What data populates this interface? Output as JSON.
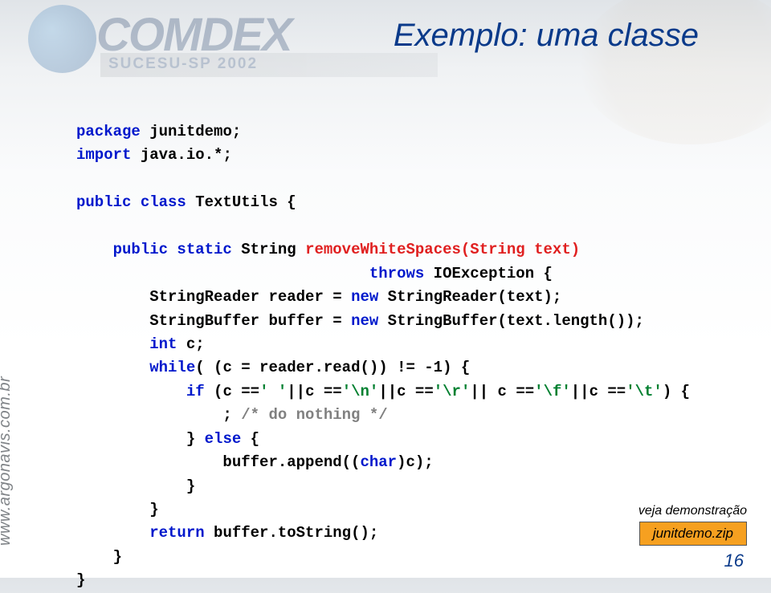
{
  "title": "Exemplo: uma  classe",
  "sidebar": "www.argonavis.com.br",
  "bg": {
    "comdex": "COMDEX",
    "sucesu": "SUCESU-SP 2002"
  },
  "code": {
    "l01a": "package",
    "l01b": " junitdemo;",
    "l02a": "import",
    "l02b": " java.io.*;",
    "l04a": "public class",
    "l04b": " TextUtils {",
    "l06a": "    ",
    "l06b": "public static",
    "l06c": " String ",
    "l06d": "removeWhiteSpaces(String text)",
    "l07a": "                                ",
    "l07b": "throws",
    "l07c": " IOException {",
    "l08a": "        StringReader reader = ",
    "l08b": "new",
    "l08c": " StringReader(text);",
    "l09a": "        StringBuffer buffer = ",
    "l09b": "new",
    "l09c": " StringBuffer(text.length());",
    "l10a": "        ",
    "l10b": "int",
    "l10c": " c;",
    "l11a": "        ",
    "l11b": "while",
    "l11c": "( (c = reader.read()) != -1) {",
    "l12a": "            ",
    "l12b": "if",
    "l12c": " (c ==",
    "l12d": "' '",
    "l12e": "||c ==",
    "l12f": "'\\n'",
    "l12g": "||c ==",
    "l12h": "'\\r'",
    "l12i": "|| c ==",
    "l12j": "'\\f'",
    "l12k": "||c ==",
    "l12l": "'\\t'",
    "l12m": ") {",
    "l13a": "                ; ",
    "l13b": "/* do nothing */",
    "l14a": "            } ",
    "l14b": "else",
    "l14c": " {",
    "l15a": "                buffer.append((",
    "l15b": "char",
    "l15c": ")c);",
    "l16": "            }",
    "l17": "        }",
    "l18a": "        ",
    "l18b": "return",
    "l18c": " buffer.toString();",
    "l19": "    }",
    "l20": "}"
  },
  "demo": {
    "caption": "veja demonstração",
    "badge": "junitdemo.zip"
  },
  "pagenum": "16"
}
